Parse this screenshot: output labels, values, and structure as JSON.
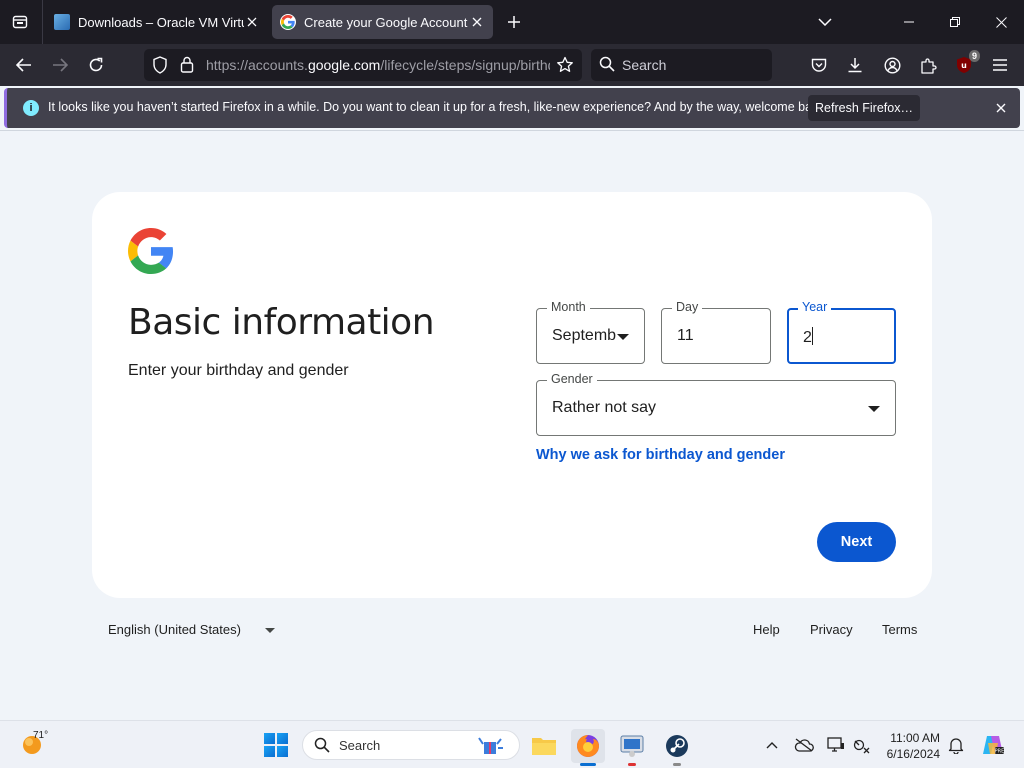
{
  "browser": {
    "tabs": [
      {
        "title": "Downloads – Oracle VM VirtualBox",
        "active": false
      },
      {
        "title": "Create your Google Account",
        "active": true
      }
    ],
    "url": {
      "prefix": "https://accounts.",
      "domain": "google.com",
      "path": "/lifecycle/steps/signup/birthdaygender"
    },
    "search_placeholder": "Search",
    "extension_badge": "9",
    "notification": {
      "message": "It looks like you haven’t started Firefox in a while. Do you want to clean it up for a fresh, like-new experience? And by the way, welcome back!",
      "button": "Refresh Firefox…",
      "info_glyph": "i"
    }
  },
  "page": {
    "heading": "Basic information",
    "subheading": "Enter your birthday and gender",
    "fields": {
      "month": {
        "label": "Month",
        "value": "Septemb"
      },
      "day": {
        "label": "Day",
        "value": "11"
      },
      "year": {
        "label": "Year",
        "value": "2"
      },
      "gender": {
        "label": "Gender",
        "value": "Rather not say"
      }
    },
    "why_link": "Why we ask for birthday and gender",
    "next_button": "Next",
    "footer": {
      "language": "English (United States)",
      "links": [
        "Help",
        "Privacy",
        "Terms"
      ]
    },
    "colors": {
      "primary": "#0b57d0",
      "background": "#f0f4f9"
    }
  },
  "taskbar": {
    "temperature": "71°",
    "search_placeholder": "Search",
    "time": "11:00 AM",
    "date": "6/16/2024"
  }
}
